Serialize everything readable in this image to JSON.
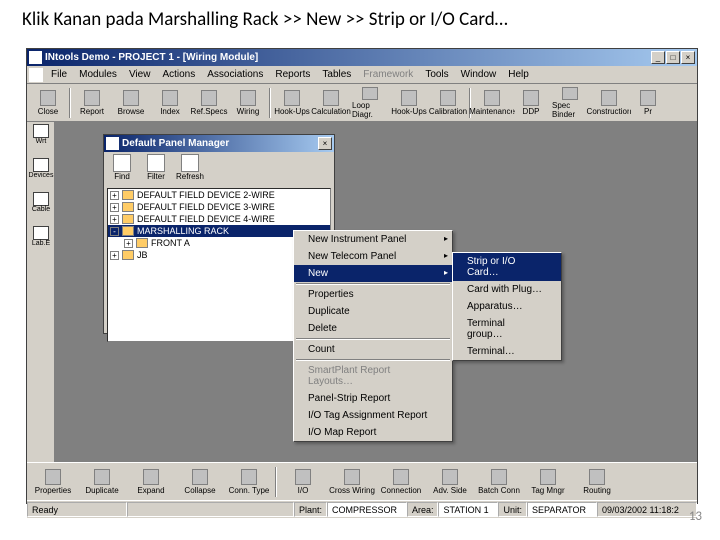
{
  "slide": {
    "title": "Klik Kanan pada Marshalling Rack  >> New >> Strip or I/O Card…",
    "page": "13"
  },
  "window": {
    "title": "INtools Demo - PROJECT 1 - [Wiring Module]"
  },
  "menubar": [
    "File",
    "Modules",
    "View",
    "Actions",
    "Associations",
    "Reports",
    "Tables",
    "Framework",
    "Tools",
    "Window",
    "Help"
  ],
  "toolbar_top": [
    "Close",
    "Report",
    "Browse",
    "Index",
    "Ref.Specs",
    "Wiring",
    "Hook-Ups",
    "Calculation",
    "Loop Diagr.",
    "Hook-Ups",
    "Calibration",
    "Maintenance",
    "DDP",
    "Spec Binder",
    "Construction",
    "Pr"
  ],
  "left_dock": [
    "Wrt",
    "Devices",
    "Cable",
    "Lab.E"
  ],
  "panel_mgr": {
    "title": "Default Panel Manager",
    "tb": [
      "Find",
      "Filter",
      "Refresh"
    ],
    "tree": [
      {
        "indent": 0,
        "exp": "+",
        "label": "DEFAULT FIELD DEVICE 2-WIRE"
      },
      {
        "indent": 0,
        "exp": "+",
        "label": "DEFAULT FIELD DEVICE 3-WIRE"
      },
      {
        "indent": 0,
        "exp": "+",
        "label": "DEFAULT FIELD DEVICE 4-WIRE"
      },
      {
        "indent": 0,
        "exp": "-",
        "label": "MARSHALLING RACK",
        "sel": true
      },
      {
        "indent": 1,
        "exp": "+",
        "label": "FRONT A"
      },
      {
        "indent": 0,
        "exp": "+",
        "label": "JB"
      }
    ]
  },
  "context_menu_1": [
    {
      "label": "New Instrument Panel",
      "arrow": true
    },
    {
      "label": "New Telecom Panel",
      "arrow": true
    },
    {
      "label": "New",
      "arrow": true,
      "hl": true
    },
    {
      "sep": true
    },
    {
      "label": "Properties"
    },
    {
      "label": "Duplicate"
    },
    {
      "label": "Delete"
    },
    {
      "sep": true
    },
    {
      "label": "Count"
    },
    {
      "sep": true
    },
    {
      "label": "SmartPlant Report Layouts…",
      "dis": true
    },
    {
      "label": "Panel-Strip Report"
    },
    {
      "label": "I/O Tag Assignment Report"
    },
    {
      "label": "I/O Map Report"
    }
  ],
  "context_menu_2": [
    {
      "label": "Strip or I/O Card…",
      "hl": true
    },
    {
      "label": "Card with Plug…"
    },
    {
      "label": "Apparatus…"
    },
    {
      "label": "Terminal group…"
    },
    {
      "label": "Terminal…"
    }
  ],
  "toolbar_bottom": [
    "Properties",
    "Duplicate",
    "Expand",
    "Collapse",
    "Conn. Type",
    "I/O",
    "Cross Wiring",
    "Connection",
    "Adv. Side",
    "Batch Conn",
    "Tag Mngr",
    "Routing"
  ],
  "statusbar": {
    "ready": "Ready",
    "plant_lbl": "Plant:",
    "plant": "COMPRESSOR",
    "area_lbl": "Area:",
    "area": "STATION 1",
    "unit_lbl": "Unit:",
    "unit": "SEPARATOR",
    "time": "09/03/2002 11:18:2"
  }
}
